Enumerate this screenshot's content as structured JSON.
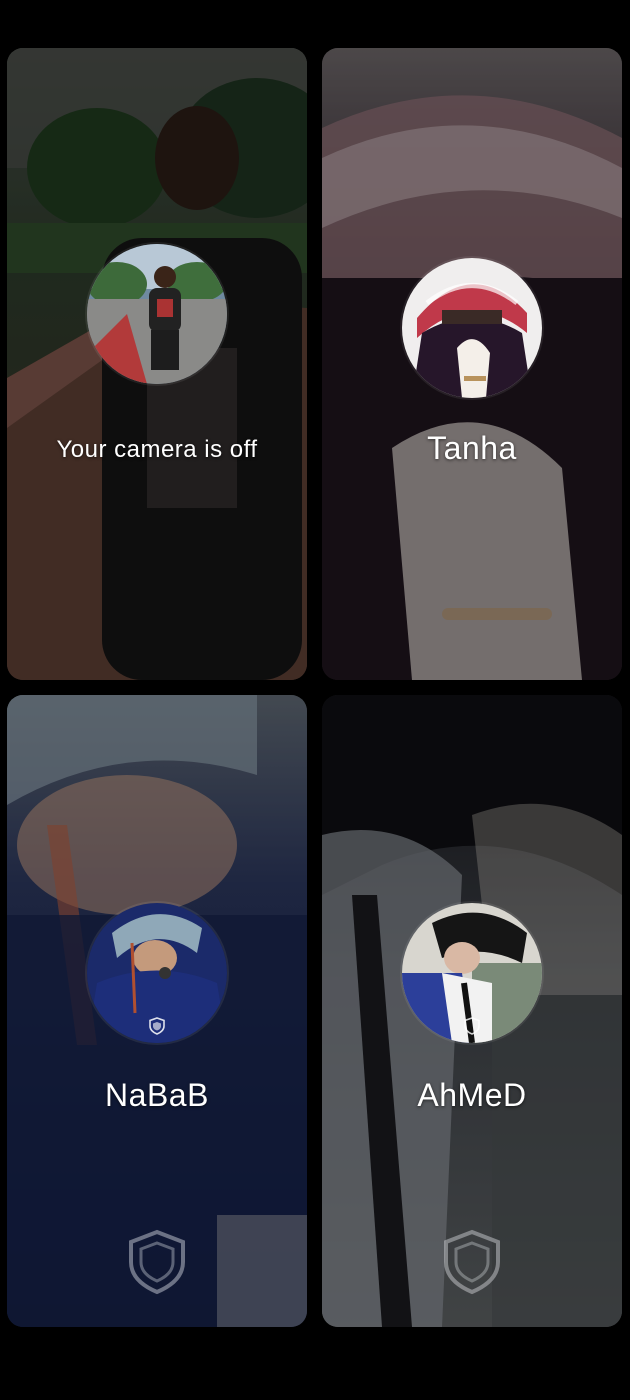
{
  "tiles": [
    {
      "id": "self",
      "label": "Your camera is off",
      "avatar_icon": "user-photo",
      "colors": {
        "bg_top": "#3b3f3a",
        "bg_mid": "#2a2f2a",
        "bg_bottom": "#5a3a32"
      }
    },
    {
      "id": "tanha",
      "label": "Tanha",
      "avatar_icon": "user-photo",
      "colors": {
        "bg_top": "#5e5a5c",
        "bg_mid": "#2b1f2a",
        "bg_bottom": "#1b1218"
      }
    },
    {
      "id": "nabab",
      "label": "NaBaB",
      "avatar_icon": "user-photo",
      "badge_icon": "shield-icon",
      "colors": {
        "bg_top": "#5a6470",
        "bg_mid": "#1c2a55",
        "bg_bottom": "#0f1a3a"
      }
    },
    {
      "id": "ahmed",
      "label": "AhMeD",
      "avatar_icon": "user-photo",
      "badge_icon": "shield-icon",
      "colors": {
        "bg_top": "#1a1a1e",
        "bg_mid": "#4a4f55",
        "bg_bottom": "#6a6f70"
      }
    }
  ]
}
